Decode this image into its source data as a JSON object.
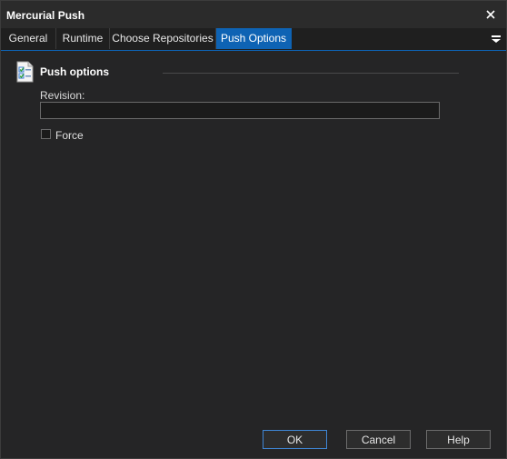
{
  "window": {
    "title": "Mercurial Push",
    "close_icon": "close-icon"
  },
  "tabs": [
    {
      "label": "General",
      "active": false
    },
    {
      "label": "Runtime",
      "active": false
    },
    {
      "label": "Choose Repositories",
      "active": false
    },
    {
      "label": "Push Options",
      "active": true
    }
  ],
  "tab_menu_icon": "dropdown-menu-icon",
  "section": {
    "title": "Push options",
    "icon": "checklist-icon"
  },
  "fields": {
    "revision_label": "Revision:",
    "revision_value": "",
    "force_label": "Force",
    "force_checked": false
  },
  "buttons": {
    "ok": "OK",
    "cancel": "Cancel",
    "help": "Help"
  },
  "colors": {
    "background": "#252526",
    "titlebar": "#2b2b2b",
    "tabbar": "#1f1f1f",
    "accent": "#0e63b4",
    "default_button_border": "#3f86d4"
  }
}
